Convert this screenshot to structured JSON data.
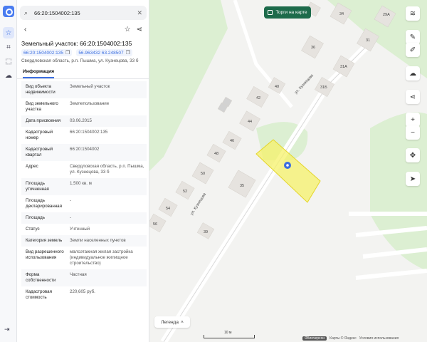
{
  "search": {
    "value": "66:20:1504002:135"
  },
  "panel": {
    "title": "Земельный участок: 66:20:1504002:135",
    "cadastral_chip": "66:20:1504002:135",
    "coords_chip": "56.963432 63.248507",
    "address_line": "Свердловская область, р.п. Пышма, ул. Кузнецова, 33 б",
    "tab": "Информация",
    "rows": [
      {
        "k": "Вид объекта недвижимости",
        "v": "Земельный участок"
      },
      {
        "k": "Вид земельного участка",
        "v": "Землепользование"
      },
      {
        "k": "Дата присвоения",
        "v": "03.06.2015"
      },
      {
        "k": "Кадастровый номер",
        "v": "66:20:1504002:135"
      },
      {
        "k": "Кадастровый квартал",
        "v": "66:20:1504002"
      },
      {
        "k": "Адрес",
        "v": "Свердловская область, р.п. Пышма, ул. Кузнецова, 33 б"
      },
      {
        "k": "Площадь уточненная",
        "v": "1,500 кв. м"
      },
      {
        "k": "Площадь декларированная",
        "v": "-"
      },
      {
        "k": "Площадь",
        "v": "-"
      },
      {
        "k": "Статус",
        "v": "Учтенный"
      },
      {
        "k": "Категория земель",
        "v": "Земли населенных пунктов"
      },
      {
        "k": "Вид разрешенного использования",
        "v": "малоэтажная жилая застройка (индивидуальное жилищное строительство)"
      },
      {
        "k": "Форма собственности",
        "v": "Частная"
      },
      {
        "k": "Кадастровая стоимость",
        "v": "220,605 руб."
      }
    ]
  },
  "map": {
    "torgi_label": "Торги на карте",
    "legend_label": "Легенда",
    "scale_label": "10 м",
    "street_label": "ул. Кузнецова",
    "attribution_badge": "Яблочерсон",
    "attribution_maps": "Карты © Яндекс",
    "attribution_terms": "Условия использования",
    "house_numbers": [
      "34",
      "29А",
      "36",
      "31",
      "31А",
      "31Б",
      "40",
      "42",
      "44",
      "46",
      "48",
      "50",
      "52",
      "54",
      "56",
      "35",
      "39"
    ]
  },
  "colors": {
    "accent": "#3b6ee0",
    "torgi_bg": "#1d6b4b",
    "parcel_fill": "#f5f26a",
    "green_area": "#dcefd2"
  }
}
